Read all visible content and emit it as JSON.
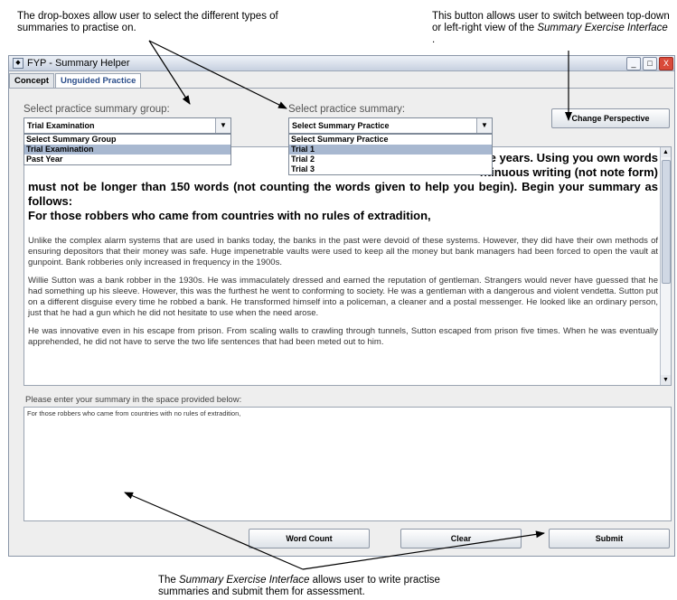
{
  "annotations": {
    "top_left": "The drop-boxes allow user to select the different types of summaries to practise on.",
    "top_right_pre": "This button allows user to switch between top-down or left-right view of the",
    "top_right_em": "Summary Exercise Interface",
    "top_right_post": " .",
    "bottom_pre": "The ",
    "bottom_em": "Summary Exercise Interface",
    "bottom_post": "  allows user to write practise summaries and submit them for assessment."
  },
  "window": {
    "title": "FYP - Summary Helper",
    "controls": [
      "_",
      "□",
      "X"
    ]
  },
  "tabs": [
    {
      "label": "Concept",
      "active": false
    },
    {
      "label": "Unguided Practice",
      "active": true
    }
  ],
  "group_select": {
    "label": "Select practice summary group:",
    "value": "Trial Examination",
    "options": [
      {
        "label": "Select Summary Group",
        "selected": false
      },
      {
        "label": "Trial Examination",
        "selected": true
      },
      {
        "label": "Past Year",
        "selected": false
      }
    ]
  },
  "summary_select": {
    "label": "Select practice summary:",
    "value": "Select Summary Practice",
    "options": [
      {
        "label": "Select Summary Practice",
        "selected": false
      },
      {
        "label": "Trial 1",
        "selected": true
      },
      {
        "label": "Trial 2",
        "selected": false
      },
      {
        "label": "Trial 3",
        "selected": false
      }
    ]
  },
  "change_perspective_label": "Change Perspective",
  "question": {
    "line1_tail": "e years. Using you own words",
    "line2_tail": "ntinuous writing (not note form)",
    "line3": "must not be longer than 150 words (not counting the words given to help you begin). Begin your summary as follows:",
    "line4": "For those robbers who came from countries with no rules of extradition,"
  },
  "passage": [
    "Unlike the complex alarm systems that are used in banks today, the banks in the past were devoid of these systems. However, they did have their own methods of ensuring depositors that their money was safe. Huge impenetrable vaults were used to keep all the money but bank managers had been forced to open the vault at gunpoint. Bank robberies only increased in frequency in the 1900s.",
    "Willie Sutton was a bank robber in the 1930s. He was immaculately dressed and earned the reputation of gentleman. Strangers would never have guessed that he had something up his sleeve. However, this was the furthest he went to conforming to society. He was a gentleman with a dangerous and violent vendetta. Sutton put on a different disguise every time he robbed a bank. He transformed himself into a policeman, a cleaner and a postal messenger. He looked like an ordinary person, just that he had a gun which he did not hesitate to use when the need arose.",
    "He was innovative even in his escape from prison. From scaling walls to crawling through tunnels, Sutton escaped from prison five times. When he was eventually apprehended, he did not have to serve the two life sentences that had been meted out to him."
  ],
  "summary_prompt": "Please enter your summary in the space provided below:",
  "summary_text": "For those robbers who came from countries with no rules of extradition,",
  "buttons": {
    "word_count": "Word Count",
    "clear": "Clear",
    "submit": "Submit"
  }
}
